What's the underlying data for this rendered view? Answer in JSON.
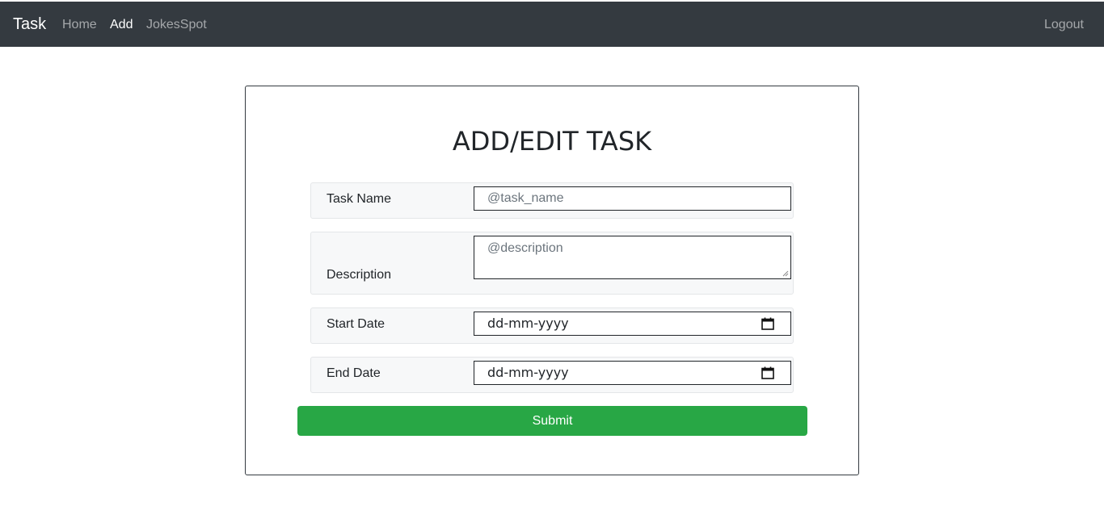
{
  "navbar": {
    "brand": "Task",
    "links": [
      {
        "label": "Home"
      },
      {
        "label": "Add"
      },
      {
        "label": "JokesSpot"
      }
    ],
    "logout_label": "Logout"
  },
  "form": {
    "title": "ADD/EDIT TASK",
    "task_name": {
      "label": "Task Name",
      "placeholder": "@task_name",
      "value": ""
    },
    "description": {
      "label": "Description",
      "placeholder": "@description",
      "value": ""
    },
    "start_date": {
      "label": "Start Date",
      "value": "dd-mm-yyyy",
      "icon": "calendar-icon"
    },
    "end_date": {
      "label": "End Date",
      "value": "dd-mm-yyyy",
      "icon": "calendar-icon"
    },
    "submit_label": "Submit"
  },
  "colors": {
    "navbar_bg": "#343a40",
    "submit_bg": "#28a745",
    "group_bg": "#f7f8f9"
  }
}
